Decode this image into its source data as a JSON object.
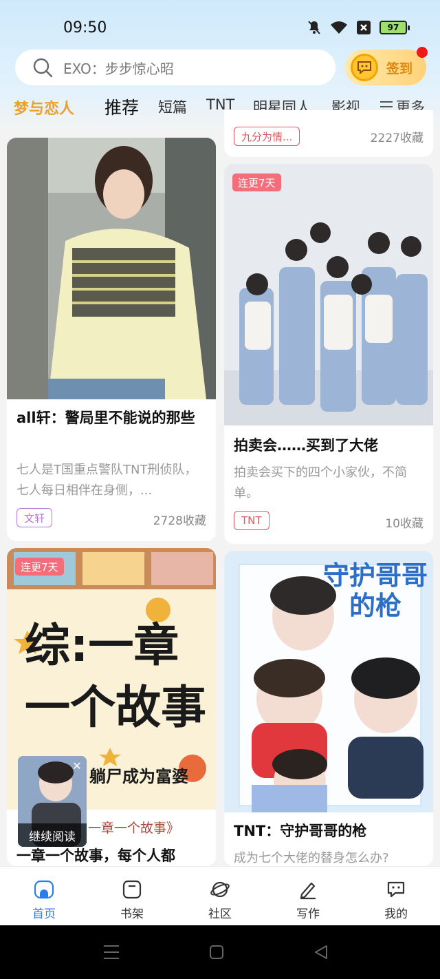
{
  "status": {
    "time": "09:50",
    "battery": "97"
  },
  "search": {
    "placeholder": "EXO：步步惊心昭"
  },
  "signin": {
    "label": "签到"
  },
  "tabs": [
    {
      "label": "梦与恋人",
      "active": true
    },
    {
      "label": "推荐"
    },
    {
      "label": "短篇"
    },
    {
      "label": "TNT"
    },
    {
      "label": "明星同人"
    },
    {
      "label": "影视"
    }
  ],
  "more_label": "更多",
  "top_partial": {
    "tag": "九分为情...",
    "favorites": "2227收藏"
  },
  "cards": [
    {
      "title": "all轩：警局里不能说的那些",
      "desc": "七人是T国重点警队TNT刑侦队，七人每日相伴在身侧，...",
      "tag": "文轩",
      "favorites": "2728收藏"
    },
    {
      "badge": "连更7天",
      "title": "拍卖会……买到了大佬",
      "desc": "拍卖会买下的四个小家伙，不简单。",
      "tag": "TNT",
      "favorites": "10收藏"
    },
    {
      "badge": "连更7天",
      "cover_line1": "综:一章",
      "cover_line2": "一个故事",
      "cover_sub": "躺尸成为富婆",
      "cover_subtitle": "一章一个故事》",
      "title": "一章一个故事，每个人都"
    },
    {
      "cover_title": "守护哥哥的枪",
      "title": "TNT：守护哥哥的枪",
      "desc": "成为七个大佬的替身怎么办?"
    }
  ],
  "continue_reading": {
    "label": "继续阅读"
  },
  "bottom_nav": [
    {
      "label": "首页",
      "active": true
    },
    {
      "label": "书架"
    },
    {
      "label": "社区"
    },
    {
      "label": "写作"
    },
    {
      "label": "我的"
    }
  ],
  "colors": {
    "accent": "#e9a12a",
    "nav_active": "#2b7de9",
    "tag_purple": "#b377d6",
    "tag_red": "#e2555d",
    "badge": "#f36e7a"
  }
}
